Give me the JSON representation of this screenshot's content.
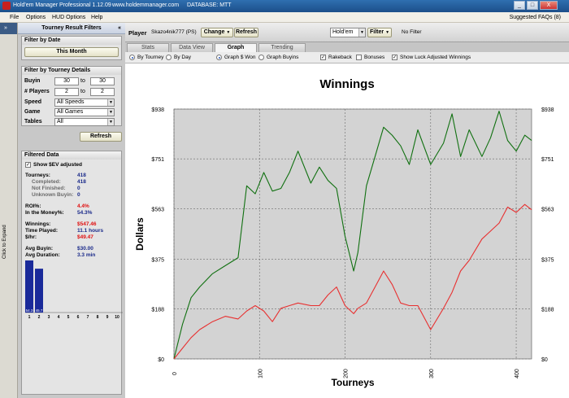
{
  "window": {
    "title": "Hold'em Manager Professional 1.12.09",
    "url": "www.holdemmanager.com",
    "database": "DATABASE: MTT",
    "controls": [
      "_",
      "□",
      "X"
    ]
  },
  "menu": {
    "items": [
      "File",
      "Options",
      "HUD Options",
      "Help"
    ],
    "suggested": "Suggested FAQs (8)"
  },
  "sidebar": {
    "expand_label": "Click to Expand",
    "expand_arrow": "»"
  },
  "filters": {
    "header": "Tourney Result Filters",
    "collapse": "«",
    "by_date": {
      "heading": "Filter by Date",
      "button": "This Month"
    },
    "by_tourney": {
      "heading": "Filter by Tourney Details",
      "buyin_label": "Buyin",
      "buyin_from": "30",
      "buyin_to": "30",
      "players_label": "# Players",
      "players_from": "2",
      "players_to": "2",
      "to_word": "to",
      "speed_label": "Speed",
      "speed_value": "All Speeds",
      "game_label": "Game",
      "game_value": "All Games",
      "tables_label": "Tables",
      "tables_value": "All"
    },
    "refresh": "Refresh"
  },
  "filtered_data": {
    "heading": "Filtered Data",
    "ev_label": "Show $EV adjusted",
    "ev_checked": "✓",
    "tourneys_label": "Tourneys:",
    "tourneys": "418",
    "completed_label": "Completed:",
    "completed": "418",
    "not_finished_label": "Not Finished:",
    "not_finished": "0",
    "unknown_label": "Unknown Buyin:",
    "unknown": "0",
    "roi_label": "ROI%:",
    "roi": "4.4%",
    "itm_label": "In the Money%:",
    "itm": "54.3%",
    "winnings_label": "Winnings:",
    "winnings": "$547.46",
    "time_label": "Time Played:",
    "time": "11.1 hours",
    "hr_label": "$/hr:",
    "hr": "$49.47",
    "avg_buyin_label": "Avg Buyin:",
    "avg_buyin": "$30.00",
    "avg_duration_label": "Avg Duration:",
    "avg_duration": "3.3 min",
    "histogram": {
      "bars": [
        54.3,
        45.7,
        0,
        0,
        0,
        0,
        0,
        0,
        0,
        0
      ],
      "bar_labels": [
        "54.3",
        "45.7"
      ],
      "x_labels": [
        "1",
        "2",
        "3",
        "4",
        "5",
        "6",
        "7",
        "8",
        "9",
        "10"
      ],
      "bar_color": "#1a2a9a"
    }
  },
  "playerbar": {
    "player_label": "Player",
    "player_name": "Skazo4nik777 (PS)",
    "change": "Change",
    "refresh": "Refresh",
    "game": "Hold'em",
    "filter": "Filter",
    "no_filter": "No Filter"
  },
  "tabs": [
    "Stats",
    "Data View",
    "Graph",
    "Trending"
  ],
  "active_tab": "Graph",
  "options": {
    "by_tourney": "By Tourney",
    "by_day": "By Day",
    "graph_won": "Graph $ Won",
    "graph_buyins": "Graph Buyins",
    "rakeback": "Rakeback",
    "bonuses": "Bonuses",
    "luck": "Show Luck Adjusted Winnings"
  },
  "chart_data": {
    "type": "line",
    "title": "Winnings",
    "xlabel": "Tourneys",
    "ylabel": "Dollars",
    "xlim": [
      0,
      418
    ],
    "ylim": [
      0,
      938
    ],
    "yticks": [
      "$0",
      "$188",
      "$375",
      "$563",
      "$751",
      "$938"
    ],
    "ytick_values": [
      0,
      188,
      375,
      563,
      751,
      938
    ],
    "xticks": [
      "0",
      "100",
      "200",
      "300",
      "400"
    ],
    "xtick_values": [
      0,
      100,
      200,
      300,
      400
    ],
    "grid": true,
    "colors": {
      "plot_bg": "#d3d3d3",
      "ev": "#107010",
      "won": "#e83030"
    },
    "series": [
      {
        "key": "ev",
        "x": [
          0,
          10,
          20,
          30,
          45,
          60,
          75,
          85,
          95,
          105,
          115,
          125,
          135,
          145,
          160,
          170,
          180,
          190,
          200,
          210,
          215,
          225,
          235,
          245,
          255,
          265,
          275,
          285,
          300,
          315,
          325,
          335,
          345,
          360,
          370,
          380,
          390,
          400,
          410,
          418
        ],
        "values": [
          0,
          130,
          230,
          270,
          320,
          350,
          380,
          650,
          620,
          700,
          630,
          640,
          700,
          780,
          660,
          720,
          670,
          640,
          460,
          330,
          400,
          650,
          760,
          870,
          840,
          800,
          730,
          860,
          730,
          810,
          920,
          760,
          860,
          760,
          830,
          930,
          820,
          780,
          840,
          820
        ]
      },
      {
        "key": "won",
        "x": [
          0,
          10,
          20,
          30,
          45,
          60,
          75,
          85,
          95,
          105,
          115,
          125,
          135,
          145,
          160,
          170,
          180,
          190,
          200,
          210,
          215,
          225,
          235,
          245,
          255,
          265,
          275,
          285,
          300,
          315,
          325,
          335,
          345,
          360,
          370,
          380,
          390,
          400,
          410,
          418
        ],
        "values": [
          0,
          40,
          80,
          110,
          140,
          160,
          150,
          180,
          200,
          180,
          140,
          190,
          200,
          210,
          200,
          200,
          240,
          270,
          200,
          170,
          190,
          210,
          270,
          330,
          280,
          210,
          200,
          200,
          110,
          190,
          250,
          330,
          370,
          450,
          480,
          510,
          570,
          550,
          580,
          560
        ]
      }
    ]
  }
}
